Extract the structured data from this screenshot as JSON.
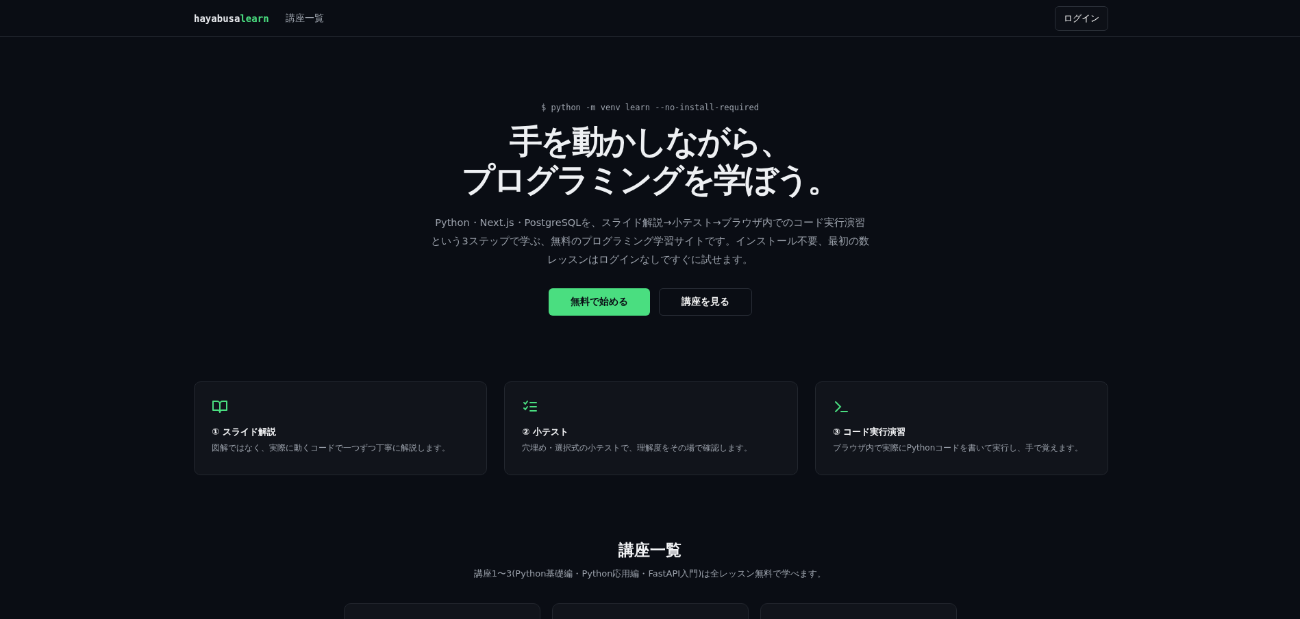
{
  "header": {
    "logo": {
      "part_1": "hayabusa",
      "part_2": "learn"
    },
    "nav": [
      {
        "label": "講座一覧"
      }
    ],
    "login": "ログイン"
  },
  "hero": {
    "command": "$ python -m venv learn --no-install-required",
    "title_lines": [
      "手を動かしながら、",
      "プログラミングを学ぼう。"
    ],
    "description": "Python・Next.js・PostgreSQLを、スライド解説→小テスト→ブラウザ内でのコード実行演習という3ステップで学ぶ、無料のプログラミング学習サイトです。インストール不要、最初の数レッスンはログインなしですぐに試せます。",
    "buttons": [
      {
        "label": "無料で始める",
        "kind": "primary"
      },
      {
        "label": "講座を見る",
        "kind": "outline"
      }
    ]
  },
  "features": [
    {
      "kind": "book",
      "title": "① スライド解説",
      "text": "図解ではなく、実際に動くコードで一つずつ丁寧に解説します。"
    },
    {
      "kind": "checklist",
      "title": "② 小テスト",
      "text": "穴埋め・選択式の小テストで、理解度をその場で確認します。"
    },
    {
      "kind": "terminal",
      "title": "③ コード実行演習",
      "text": "ブラウザ内で実際にPythonコードを書いて実行し、手で覚えます。"
    }
  ],
  "courses": {
    "title": "講座一覧",
    "subtitle": "講座1〜3(Python基礎編・Python応用編・FastAPI入門)は全レッスン無料で学べます。",
    "cards": [
      {
        "kind": "card"
      },
      {
        "kind": "card"
      },
      {
        "kind": "card"
      }
    ]
  }
}
